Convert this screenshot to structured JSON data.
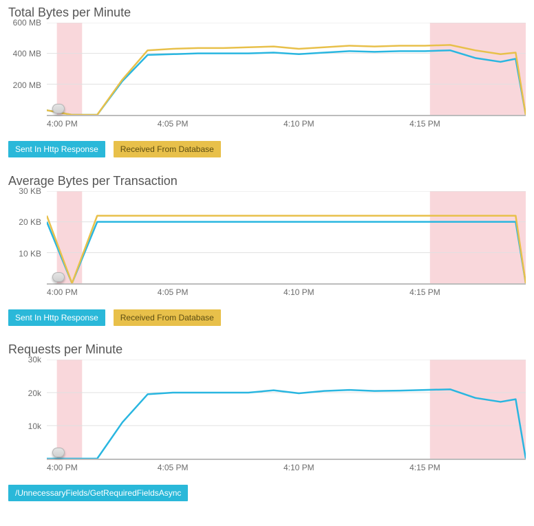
{
  "time_axis": {
    "start_min": 0,
    "end_min": 19,
    "ticks": [
      {
        "min": 0,
        "label": "4:00 PM"
      },
      {
        "min": 5,
        "label": "4:05 PM"
      },
      {
        "min": 10,
        "label": "4:10 PM"
      },
      {
        "min": 15,
        "label": "4:15 PM"
      }
    ],
    "shade1": {
      "from": 0.4,
      "to": 1.4
    },
    "shade2": {
      "from": 15.2,
      "to": 19
    }
  },
  "colors": {
    "sent": "#29b6e0",
    "recv": "#e8c04a"
  },
  "chart_data": [
    {
      "id": "total-bytes",
      "title": "Total Bytes per Minute",
      "type": "line",
      "xlabel": "",
      "ylabel": "",
      "ylim": [
        0,
        600
      ],
      "y_unit_suffix": " MB",
      "y_ticks": [
        200,
        400,
        600
      ],
      "legend": [
        "Sent In Http Response",
        "Received From Database"
      ],
      "series": [
        {
          "name": "Sent In Http Response",
          "color": "sent",
          "values": [
            30,
            0,
            0,
            220,
            390,
            395,
            400,
            400,
            400,
            405,
            395,
            405,
            415,
            410,
            415,
            415,
            420,
            370,
            345,
            365,
            0
          ]
        },
        {
          "name": "Received From Database",
          "color": "recv",
          "values": [
            30,
            0,
            0,
            230,
            420,
            430,
            435,
            435,
            440,
            445,
            430,
            440,
            450,
            445,
            450,
            450,
            455,
            420,
            395,
            405,
            0
          ]
        }
      ],
      "x": [
        0,
        1,
        2,
        3,
        4,
        5,
        6,
        7,
        8,
        9,
        10,
        11,
        12,
        13,
        14,
        15,
        16,
        17,
        18,
        18.6,
        19
      ]
    },
    {
      "id": "avg-bytes",
      "title": "Average Bytes per Transaction",
      "type": "line",
      "xlabel": "",
      "ylabel": "",
      "ylim": [
        0,
        30
      ],
      "y_unit_suffix": " KB",
      "y_ticks": [
        10,
        20,
        30
      ],
      "legend": [
        "Sent In Http Response",
        "Received From Database"
      ],
      "series": [
        {
          "name": "Sent In Http Response",
          "color": "sent",
          "values": [
            20,
            0,
            20,
            20,
            20,
            20,
            20,
            20,
            20,
            20,
            20,
            20,
            20,
            20,
            20,
            20,
            20,
            20,
            20,
            20,
            0
          ]
        },
        {
          "name": "Received From Database",
          "color": "recv",
          "values": [
            22,
            0,
            22,
            22,
            22,
            22,
            22,
            22,
            22,
            22,
            22,
            22,
            22,
            22,
            22,
            22,
            22,
            22,
            22,
            22,
            0
          ]
        }
      ],
      "x": [
        0,
        1,
        2,
        3,
        4,
        5,
        6,
        7,
        8,
        9,
        10,
        11,
        12,
        13,
        14,
        15,
        16,
        17,
        18,
        18.6,
        19
      ]
    },
    {
      "id": "requests",
      "title": "Requests per Minute",
      "type": "line",
      "xlabel": "",
      "ylabel": "",
      "ylim": [
        0,
        30
      ],
      "y_unit_suffix": "k",
      "y_ticks": [
        10,
        20,
        30
      ],
      "legend": [
        "/UnnecessaryFields/GetRequiredFieldsAsync"
      ],
      "series": [
        {
          "name": "/UnnecessaryFields/GetRequiredFieldsAsync",
          "color": "sent",
          "values": [
            0,
            0,
            0,
            11,
            19.5,
            20,
            20,
            20,
            20,
            20.7,
            19.8,
            20.5,
            20.8,
            20.5,
            20.6,
            20.8,
            21,
            18.4,
            17.2,
            18.0,
            0
          ]
        }
      ],
      "x": [
        0,
        1,
        2,
        3,
        4,
        5,
        6,
        7,
        8,
        9,
        10,
        11,
        12,
        13,
        14,
        15,
        16,
        17,
        18,
        18.6,
        19
      ]
    }
  ]
}
